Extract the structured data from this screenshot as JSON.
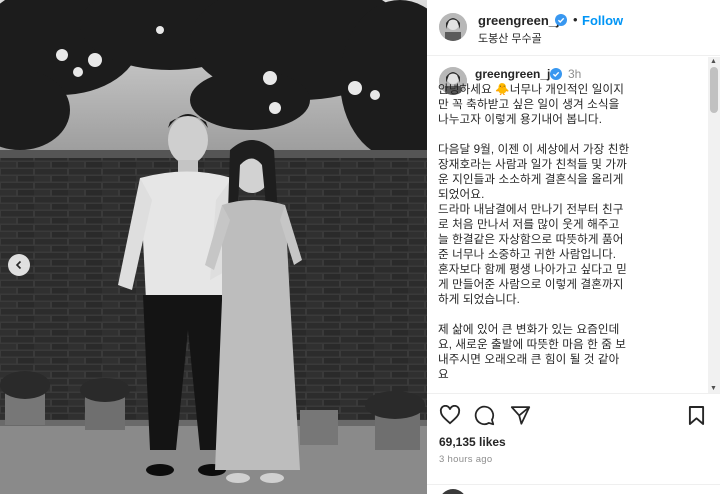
{
  "post": {
    "username": "greengreen_j",
    "follow_label": "Follow",
    "separator": "•",
    "location": "도봉산 무수골",
    "time_short": "3h",
    "caption_lines": [
      "안녕하세요 🐥너무나 개인적인 일이지",
      "만 꼭 축하받고 싶은 일이 생겨 소식을",
      "나누고자 이렇게 용기내어 봅니다.",
      "",
      "다음달 9월, 이젠 이 세상에서 가장 친한",
      "장재호라는 사람과 일가 친척들 및 가까",
      "운 지인들과 소소하게 결혼식을 올리게",
      "되었어요.",
      "드라마 내남결에서 만나기 전부터 친구",
      "로 처음 만나서 저를 많이 웃게 해주고",
      "늘 한결같은 자상함으로 따뜻하게 품어",
      "준 너무나 소중하고 귀한 사람입니다.",
      "혼자보다 함께 평생 나아가고 싶다고 믿",
      "게 만들어준 사람으로 이렇게 결혼까지",
      "하게 되었습니다.",
      "",
      "제 삶에 있어 큰 변화가 있는 요즘인데",
      "요, 새로운 출발에 따뜻한 마음 한 줌 보",
      "내주시면 오래오래 큰 힘이 될 것 같아",
      "요"
    ],
    "likes": "69,135 likes",
    "time_ago": "3 hours ago"
  },
  "icons": {
    "verified": "verified-badge-icon",
    "like": "heart-icon",
    "comment": "comment-icon",
    "share": "share-icon",
    "save": "bookmark-icon",
    "prev": "chevron-left-icon"
  },
  "colors": {
    "accent": "#0095f6",
    "verified": "#3897f0",
    "muted": "#8e8e8e",
    "text": "#262626"
  }
}
